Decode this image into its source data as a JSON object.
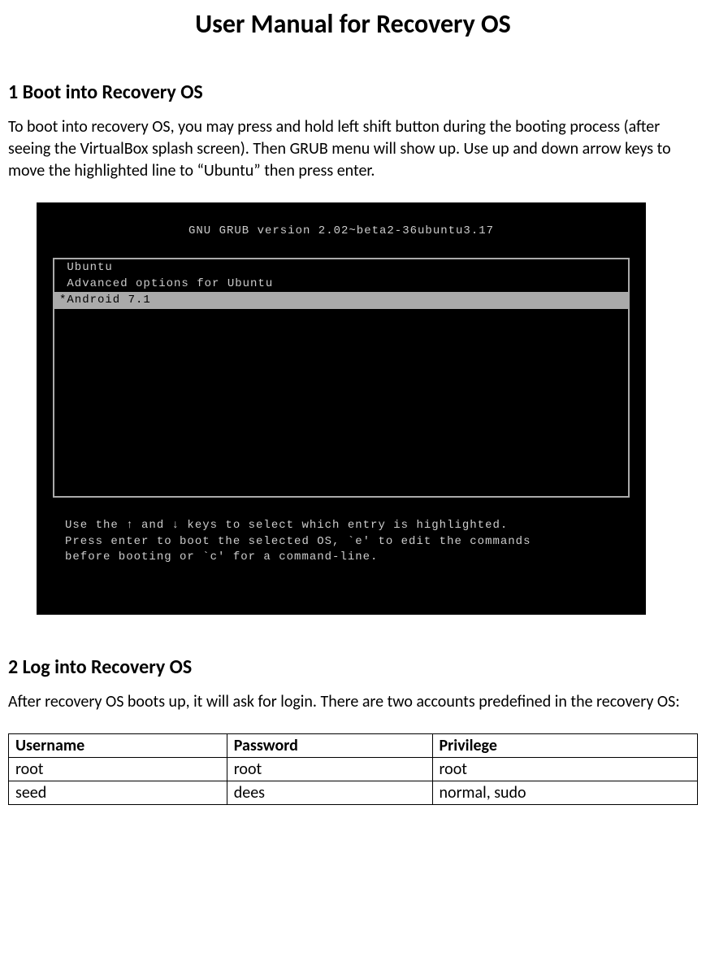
{
  "title": "User Manual for Recovery OS",
  "section1": {
    "heading": "1 Boot into Recovery OS",
    "paragraph": "To boot into recovery OS, you may press and hold left shift button during the booting process (after seeing the VirtualBox splash screen). Then GRUB menu will show up. Use up and down arrow keys to move the highlighted line to “Ubuntu” then press enter."
  },
  "grub": {
    "header": "GNU GRUB  version 2.02~beta2-36ubuntu3.17",
    "entries": [
      {
        "label": " Ubuntu",
        "selected": false
      },
      {
        "label": " Advanced options for Ubuntu",
        "selected": false
      },
      {
        "label": "*Android 7.1",
        "selected": true
      }
    ],
    "footer": "Use the ↑ and ↓ keys to select which entry is highlighted.\nPress enter to boot the selected OS, `e' to edit the commands\nbefore booting or `c' for a command-line."
  },
  "section2": {
    "heading": "2 Log into Recovery OS",
    "paragraph": "After recovery OS boots up, it will ask for login. There are two accounts predefined in the recovery OS:"
  },
  "accounts": {
    "headers": [
      "Username",
      "Password",
      "Privilege"
    ],
    "rows": [
      [
        "root",
        "root",
        "root"
      ],
      [
        "seed",
        "dees",
        "normal, sudo"
      ]
    ]
  }
}
